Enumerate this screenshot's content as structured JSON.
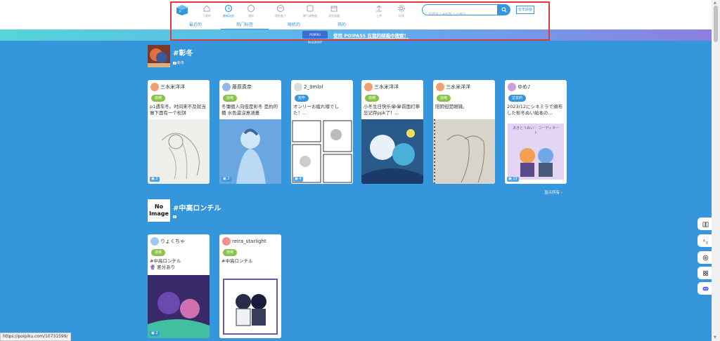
{
  "header": {
    "nav": [
      {
        "label": "下载的",
        "icon": "home-icon"
      },
      {
        "label": "最新动态",
        "icon": "clock-icon",
        "active": true
      },
      {
        "label": "通知",
        "icon": "chat-icon"
      },
      {
        "label": "我的盒子",
        "icon": "box-icon"
      },
      {
        "label": "脾气调整器",
        "icon": "tablet-icon"
      },
      {
        "label": "浏览画廊",
        "icon": "gallery-icon"
      },
      {
        "label": "上传",
        "icon": "upload-icon"
      },
      {
        "label": "环境",
        "icon": "gear-icon"
      }
    ],
    "search_placeholder": "关键字 | #标签 | @用户",
    "all_search_label": "全年龄版"
  },
  "tabs": [
    {
      "label": "最近的"
    },
    {
      "label": "热门标签",
      "active": true
    },
    {
      "label": "随机的"
    },
    {
      "label": "热的"
    }
  ],
  "banner": {
    "passport": "POIPIKU PASSPORT",
    "text": "使用 POIPASS 在我的邮箱中搜索！"
  },
  "sections": [
    {
      "title": "#彰冬",
      "sub": "彰冬",
      "show_all": "显示所有 ›",
      "cards": [
        {
          "user": "三水米洋洋",
          "badge": "烧烤",
          "desc": "p1遇车冬。时间来不及就当做下面有一个松饼",
          "count": "2",
          "avatar": "#f0a070",
          "pic": "sketch-a"
        },
        {
          "user": "藤原真奈",
          "badge": "烧烤",
          "desc": "冬彌個人向但是彰冬 是約的橋 水色還沒意涵畫",
          "count": "2",
          "avatar": "#90b8e8",
          "pic": "blue-boy"
        },
        {
          "user": "2_3mlol",
          "badge": "完毕",
          "desc": "オンリーお疲れ様でした！...",
          "count": "4",
          "avatar": "#dddddd",
          "pic": "manga"
        },
        {
          "user": "三水米洋洋",
          "badge": "烧烤",
          "desc": "小冬生日快乐😭😭前面打拳忘记存ppk了！...",
          "count": "",
          "avatar": "#f0a070",
          "pic": "color-art"
        },
        {
          "user": "三水米洋洋",
          "badge": "烧烤",
          "desc": "阳阴但是眼镜。",
          "count": "",
          "avatar": "#f0a070",
          "pic": "sketch-b"
        },
        {
          "user": "ゆめ♪",
          "badge": "过去的",
          "badge_blue": true,
          "desc": "2023/12にシネミラで頒布した彰冬ぬい絵本の...",
          "count": "13",
          "avatar": "#c8a0e0",
          "pic": "plush"
        }
      ]
    },
    {
      "title": "#中高ロンチル",
      "sub": "",
      "noimage": "No Image",
      "cards": [
        {
          "user": "りょくちゃ",
          "badge": "烧烤",
          "desc": "#中高ロンチル\n🔮 差分あり",
          "count": "2",
          "avatar": "#a0c8f0",
          "pic": "purple-art"
        },
        {
          "user": "reira_starlight",
          "badge": "烧烤",
          "desc": "#中高ロンチル",
          "count": "",
          "avatar": "#f09090",
          "pic": "frame-art"
        }
      ]
    }
  ],
  "status_url": "https://poipiku.com/10731599/",
  "side_buttons": [
    "book-icon",
    "translate-icon",
    "at-icon",
    "grid-icon",
    "discord-icon"
  ],
  "plush_caption": "あきとうぬい♡ コーディネート"
}
